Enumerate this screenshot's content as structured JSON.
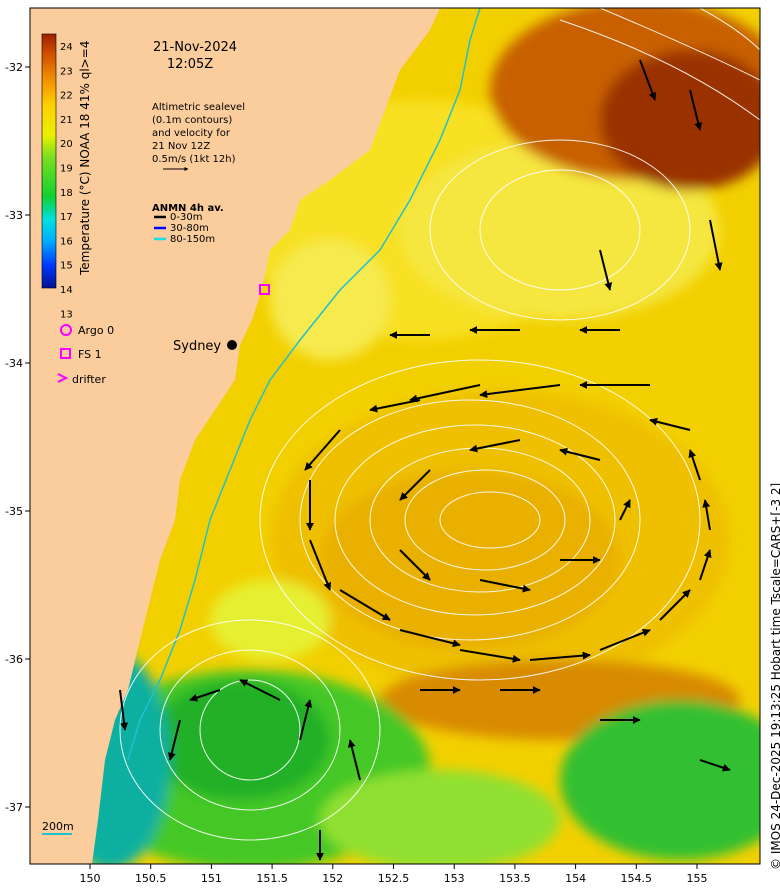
{
  "header": {
    "date": "21-Nov-2024",
    "time": "12:05Z"
  },
  "description": [
    "Altimetric sealevel",
    "(0.1m contours)",
    "and velocity for",
    "21 Nov 12Z",
    "0.5m/s (1kt 12h)"
  ],
  "anmn": {
    "title": "ANMN 4h av.",
    "items": [
      {
        "label": "0-30m",
        "color": "#000000"
      },
      {
        "label": "30-80m",
        "color": "#0000ff"
      },
      {
        "label": "80-150m",
        "color": "#00e5e5"
      }
    ]
  },
  "legend": {
    "items": [
      {
        "label": "Argo 0",
        "marker": "circle",
        "color": "#ff00ff"
      },
      {
        "label": "FS 1",
        "marker": "square",
        "color": "#ff00ff"
      },
      {
        "label": "drifter",
        "marker": "chevron",
        "color": "#ff00ff"
      }
    ]
  },
  "city": "Sydney",
  "depth_label": "200m",
  "colorbar": {
    "label": "Temperature (°C) NOAA 18 41% ql>=4",
    "ticks": [
      "24",
      "23",
      "22",
      "21",
      "20",
      "19",
      "18",
      "17",
      "16",
      "15",
      "14",
      "13"
    ],
    "range": [
      13,
      24.5
    ]
  },
  "axes": {
    "x_ticks": [
      "150",
      "150.5",
      "151",
      "151.5",
      "152",
      "152.5",
      "153",
      "153.5",
      "154",
      "154.5",
      "155"
    ],
    "y_ticks": [
      "-32",
      "-33",
      "-34",
      "-35",
      "-36",
      "-37"
    ]
  },
  "credit": "© IMOS 24-Dec-2025 19:13:25 Hobart time Tscale=CARS+[-3 2]",
  "colors": {
    "land": "#fbcc9c",
    "warm": "#e0a000",
    "hot": "#b84000",
    "cool": "#22c030",
    "isobath": "#20c0d0"
  }
}
